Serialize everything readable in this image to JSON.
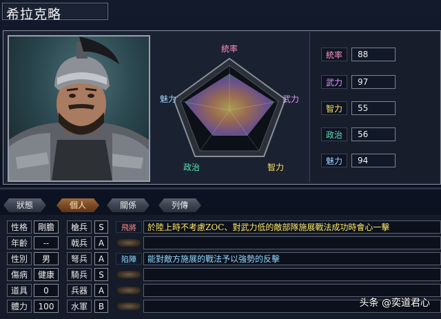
{
  "general": {
    "name": "希拉克略"
  },
  "radar": {
    "labels": [
      {
        "text": "統率",
        "color": "#ff8fc0"
      },
      {
        "text": "武力",
        "color": "#e09aff"
      },
      {
        "text": "智力",
        "color": "#ffe060"
      },
      {
        "text": "政治",
        "color": "#5be0b8"
      },
      {
        "text": "魅力",
        "color": "#9fd0ff"
      }
    ]
  },
  "stats": [
    {
      "label": "統率",
      "value": "88",
      "color": "#ff8fc0"
    },
    {
      "label": "武力",
      "value": "97",
      "color": "#e09aff"
    },
    {
      "label": "智力",
      "value": "55",
      "color": "#ffe060"
    },
    {
      "label": "政治",
      "value": "56",
      "color": "#5be0b8"
    },
    {
      "label": "魅力",
      "value": "94",
      "color": "#9fd0ff"
    }
  ],
  "tabs": [
    {
      "label": "狀態"
    },
    {
      "label": "個人"
    },
    {
      "label": "關係"
    },
    {
      "label": "列傳"
    }
  ],
  "personal": [
    {
      "label": "性格",
      "value": "剛膽"
    },
    {
      "label": "年齡",
      "value": "--"
    },
    {
      "label": "性別",
      "value": "男"
    },
    {
      "label": "傷病",
      "value": "健康"
    },
    {
      "label": "道具",
      "value": "0"
    },
    {
      "label": "體力",
      "value": "100"
    }
  ],
  "aptitudes": [
    {
      "label": "槍兵",
      "value": "S"
    },
    {
      "label": "戟兵",
      "value": "A"
    },
    {
      "label": "弩兵",
      "value": "A"
    },
    {
      "label": "騎兵",
      "value": "S"
    },
    {
      "label": "兵器",
      "value": "A"
    },
    {
      "label": "水軍",
      "value": "B"
    }
  ],
  "skills": [
    {
      "name": "飛將",
      "name_color": "#ff8888",
      "description": "於陸上時不考慮ZOC、對武力低的敵部隊施展戰法成功時會心一擊",
      "text_color": "#ffe860"
    },
    {
      "name": "",
      "description": ""
    },
    {
      "name": "陷陣",
      "name_color": "#8fd8ff",
      "description": "能對敵方施展的戰法予以強勢的反擊",
      "text_color": "#8fd8ff"
    },
    {
      "name": "",
      "description": ""
    },
    {
      "name": "",
      "description": ""
    },
    {
      "name": "",
      "description": ""
    }
  ],
  "watermark": "头条 @奕道君心"
}
